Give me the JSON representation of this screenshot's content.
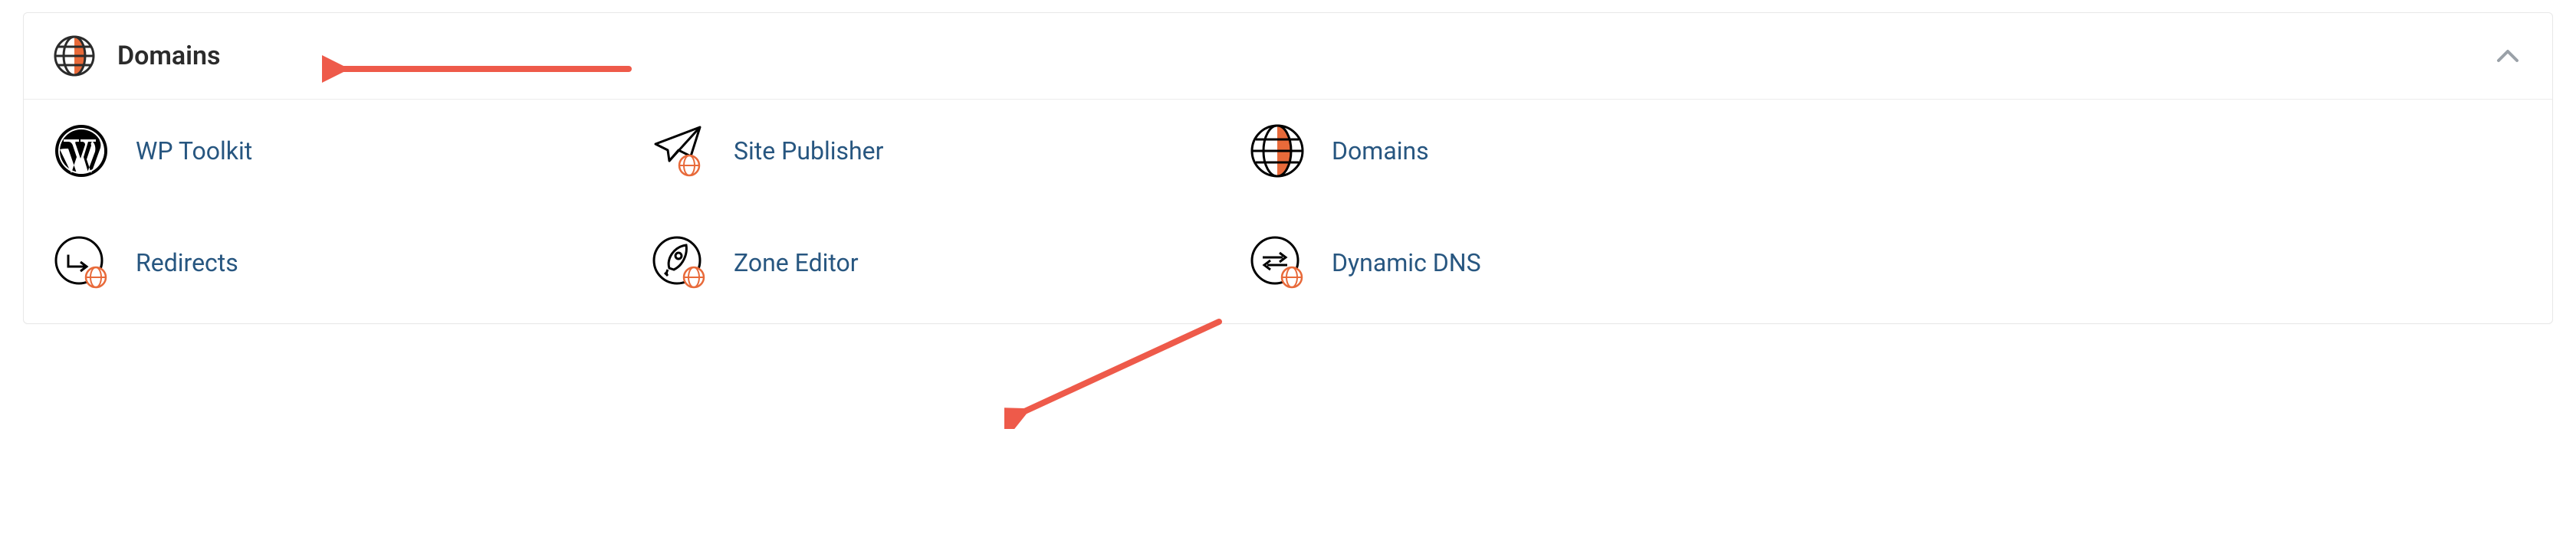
{
  "panel": {
    "title": "Domains",
    "collapsed": false
  },
  "items": [
    {
      "id": "wp-toolkit",
      "label": "WP Toolkit",
      "icon": "wordpress"
    },
    {
      "id": "site-publisher",
      "label": "Site Publisher",
      "icon": "paper-plane-globe"
    },
    {
      "id": "domains",
      "label": "Domains",
      "icon": "globe-orange"
    },
    {
      "id": "redirects",
      "label": "Redirects",
      "icon": "redirect-globe"
    },
    {
      "id": "zone-editor",
      "label": "Zone Editor",
      "icon": "rocket-globe"
    },
    {
      "id": "dynamic-dns",
      "label": "Dynamic DNS",
      "icon": "arrows-globe"
    }
  ],
  "annotations": {
    "arrow_to_title": true,
    "arrow_to_zone_editor": true
  },
  "colors": {
    "accent_orange": "#e86a3a",
    "link_blue": "#275680",
    "arrow_red": "#ee5a4a"
  }
}
